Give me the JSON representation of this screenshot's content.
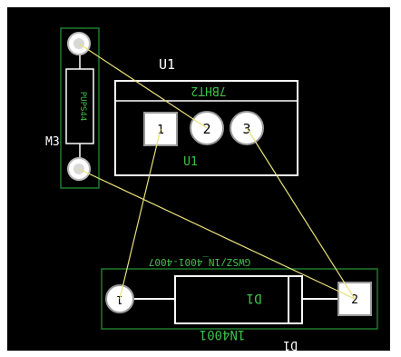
{
  "pcb": {
    "colors": {
      "background": "#000000",
      "silkscreen_white": "#ffffff",
      "silkscreen_green": "#3ec04a",
      "outline_green": "#1f7a2c",
      "ratsnest": "#e8e07a",
      "pad_fill": "#ffffff"
    },
    "labels": {
      "u1_ref": "U1",
      "u1_part": "7BHT2",
      "u1_inner": "U1",
      "resistor_ref": "M3",
      "resistor_value": "PUPS44",
      "diode_part": "1N4001",
      "diode_part_mirrored": "GWSZ/1N_4001-4007",
      "diode_ref": "D1",
      "diode_ref_bottom": "D1",
      "diode_inner": "D1"
    },
    "pads": {
      "u1_pad1": "1",
      "u1_pad2": "2",
      "u1_pad3": "3",
      "d1_pad1": "1",
      "d1_pad2": "2"
    },
    "icons": {
      "pad": "circle-pad-icon",
      "square_pad": "square-pad-icon"
    }
  }
}
